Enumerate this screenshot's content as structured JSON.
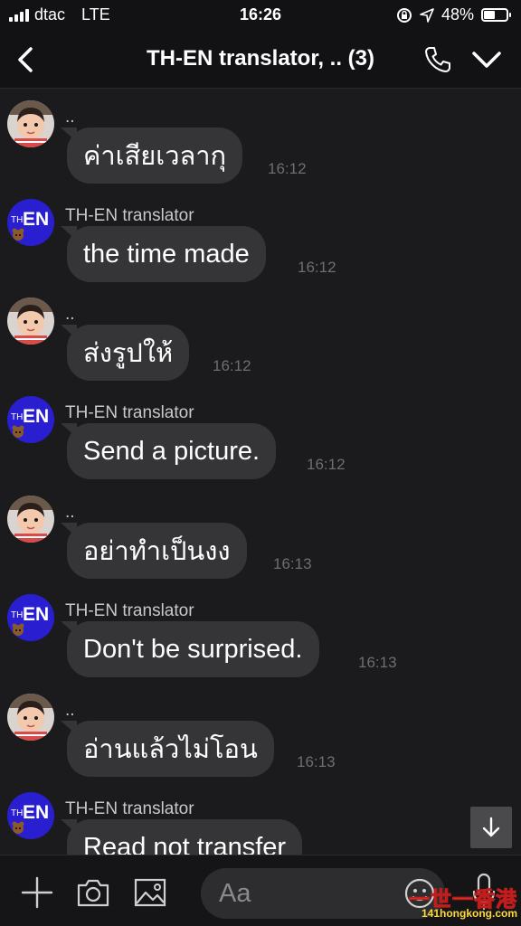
{
  "status_bar": {
    "carrier": "dtac",
    "network": "LTE",
    "time": "16:26",
    "battery": "48%",
    "battery_level": 0.48
  },
  "header": {
    "title": "TH-EN translator, .. (3)"
  },
  "bot_avatar": {
    "small": "TH",
    "big": "EN"
  },
  "messages": [
    {
      "sender": "..",
      "text": "ค่าเสียเวลากุ",
      "time": "16:12",
      "avatar": "child-photo"
    },
    {
      "sender": "TH-EN translator",
      "text": "the time made",
      "time": "16:12",
      "avatar": "th-en-logo"
    },
    {
      "sender": "..",
      "text": "ส่งรูปให้",
      "time": "16:12",
      "avatar": "child-photo"
    },
    {
      "sender": "TH-EN translator",
      "text": "Send a picture.",
      "time": "16:12",
      "avatar": "th-en-logo"
    },
    {
      "sender": "..",
      "text": "อย่าทำเป็นงง",
      "time": "16:13",
      "avatar": "child-photo"
    },
    {
      "sender": "TH-EN translator",
      "text": "Don't be surprised.",
      "time": "16:13",
      "avatar": "th-en-logo"
    },
    {
      "sender": "..",
      "text": "อ่านแล้วไม่โอน",
      "time": "16:13",
      "avatar": "child-photo"
    },
    {
      "sender": "TH-EN translator",
      "text": "Read not transfer",
      "time": "",
      "avatar": "th-en-logo"
    }
  ],
  "composer": {
    "placeholder": "Aa"
  },
  "watermark": {
    "main": "一世一香港",
    "sub": "141hongkong.com"
  },
  "colors": {
    "background": "#1b1b1d",
    "bubble": "#353537",
    "bot_avatar": "#2a1fd0",
    "timestamp": "#6e6e72"
  }
}
